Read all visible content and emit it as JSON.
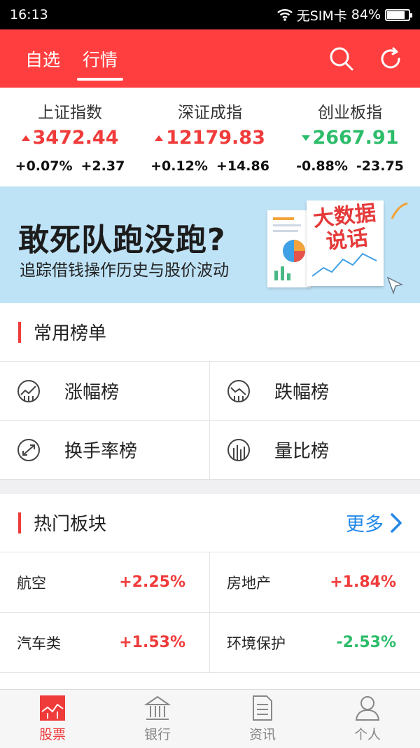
{
  "status_bar": {
    "time": "16:13",
    "carrier": "无SIM卡",
    "battery": "84%",
    "battery_level": 0.84
  },
  "nav": {
    "tabs": [
      {
        "label": "自选"
      },
      {
        "label": "行情"
      }
    ],
    "active_tab": 1,
    "icons": [
      "search-icon",
      "refresh-icon"
    ]
  },
  "indices": [
    {
      "name": "上证指数",
      "price": "3472.44",
      "pct": "+0.07%",
      "chg": "+2.37",
      "dir": "up"
    },
    {
      "name": "深证成指",
      "price": "12179.83",
      "pct": "+0.12%",
      "chg": "+14.86",
      "dir": "up"
    },
    {
      "name": "创业板指",
      "price": "2667.91",
      "pct": "-0.88%",
      "chg": "-23.75",
      "dir": "down"
    }
  ],
  "banner": {
    "headline": "敢死队跑没跑?",
    "sub": "追踪借钱操作历史与股价波动",
    "badge_line1": "大数据",
    "badge_line2": "说话"
  },
  "common_lists": {
    "title": "常用榜单",
    "items": [
      {
        "label": "涨幅榜",
        "icon": "rise-chart-icon"
      },
      {
        "label": "跌幅榜",
        "icon": "fall-chart-icon"
      },
      {
        "label": "换手率榜",
        "icon": "turnover-icon"
      },
      {
        "label": "量比榜",
        "icon": "volume-ratio-icon"
      }
    ]
  },
  "hot_sectors": {
    "title": "热门板块",
    "more": "更多",
    "items": [
      {
        "name": "航空",
        "pct": "+2.25%",
        "dir": "up"
      },
      {
        "name": "房地产",
        "pct": "+1.84%",
        "dir": "up"
      },
      {
        "name": "汽车类",
        "pct": "+1.53%",
        "dir": "up"
      },
      {
        "name": "环境保护",
        "pct": "-2.53%",
        "dir": "down"
      }
    ]
  },
  "tabbar": [
    {
      "label": "股票",
      "icon": "stock-icon",
      "active": true
    },
    {
      "label": "银行",
      "icon": "bank-icon",
      "active": false
    },
    {
      "label": "资讯",
      "icon": "news-icon",
      "active": false
    },
    {
      "label": "个人",
      "icon": "person-icon",
      "active": false
    }
  ],
  "colors": {
    "brand": "#ff3f3f",
    "up": "#f03b3b",
    "down": "#2cbd6a",
    "link": "#2389e8"
  }
}
